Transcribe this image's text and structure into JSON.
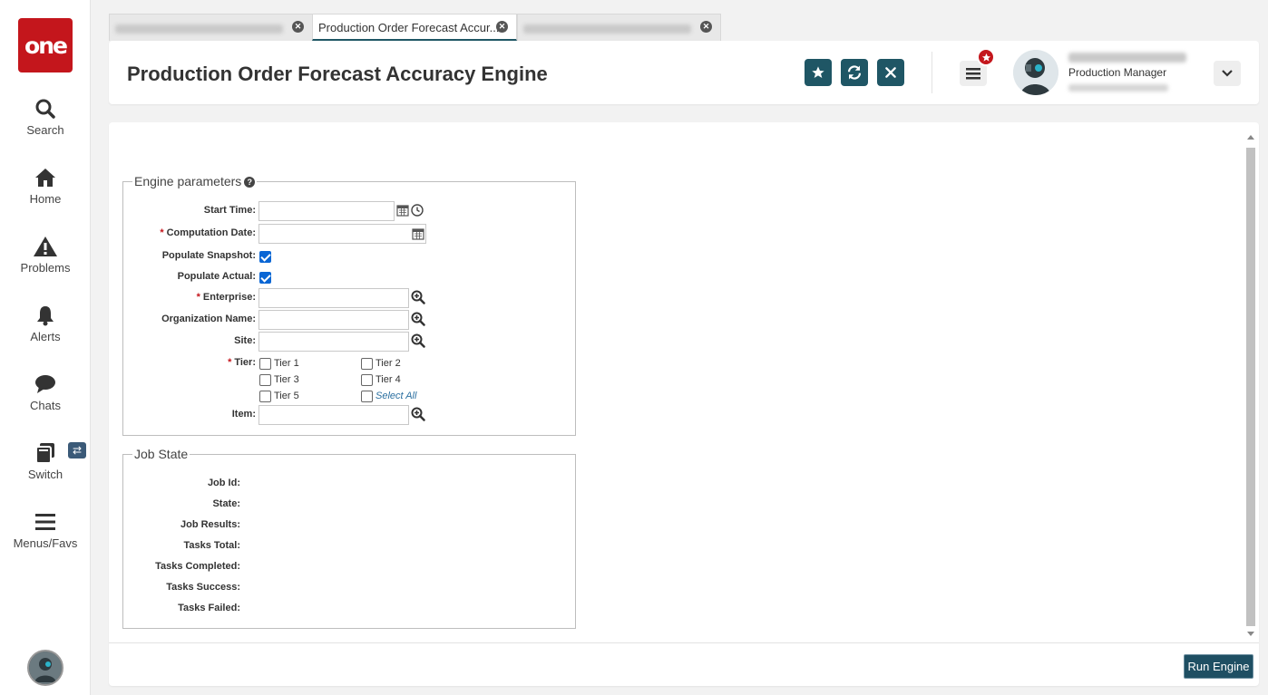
{
  "app": {
    "logo_text": "one"
  },
  "sidebar": {
    "items": [
      {
        "label": "Search",
        "icon": "search-icon"
      },
      {
        "label": "Home",
        "icon": "home-icon"
      },
      {
        "label": "Problems",
        "icon": "warning-icon"
      },
      {
        "label": "Alerts",
        "icon": "bell-icon"
      },
      {
        "label": "Chats",
        "icon": "chat-icon"
      },
      {
        "label": "Switch",
        "icon": "switch-icon"
      },
      {
        "label": "Menus/Favs",
        "icon": "hamburger-icon"
      }
    ],
    "switch_badge": "⇄"
  },
  "tabs": [
    {
      "label": "",
      "active": false
    },
    {
      "label": "Production Order Forecast Accur...",
      "active": true
    },
    {
      "label": "",
      "active": false
    }
  ],
  "header": {
    "title": "Production Order Forecast Accuracy Engine",
    "user_role": "Production Manager"
  },
  "engine_params": {
    "legend": "Engine parameters",
    "start_time": {
      "label": "Start Time:",
      "value": ""
    },
    "computation_date": {
      "label": "Computation Date:",
      "value": ""
    },
    "populate_snapshot": {
      "label": "Populate Snapshot:",
      "checked": true
    },
    "populate_actual": {
      "label": "Populate Actual:",
      "checked": true
    },
    "enterprise": {
      "label": "Enterprise:",
      "value": ""
    },
    "organization_name": {
      "label": "Organization Name:",
      "value": ""
    },
    "site": {
      "label": "Site:",
      "value": ""
    },
    "tier": {
      "label": "Tier:",
      "options": [
        "Tier 1",
        "Tier 2",
        "Tier 3",
        "Tier 4",
        "Tier 5"
      ],
      "select_all": "Select All"
    },
    "item": {
      "label": "Item:",
      "value": ""
    }
  },
  "job_state": {
    "legend": "Job State",
    "fields": [
      "Job Id:",
      "State:",
      "Job Results:",
      "Tasks Total:",
      "Tasks Completed:",
      "Tasks Success:",
      "Tasks Failed:"
    ]
  },
  "footer": {
    "run_label": "Run Engine"
  },
  "colors": {
    "brand_red": "#c4161c",
    "accent_teal": "#1f5665",
    "checkbox_blue": "#0a66d4"
  }
}
